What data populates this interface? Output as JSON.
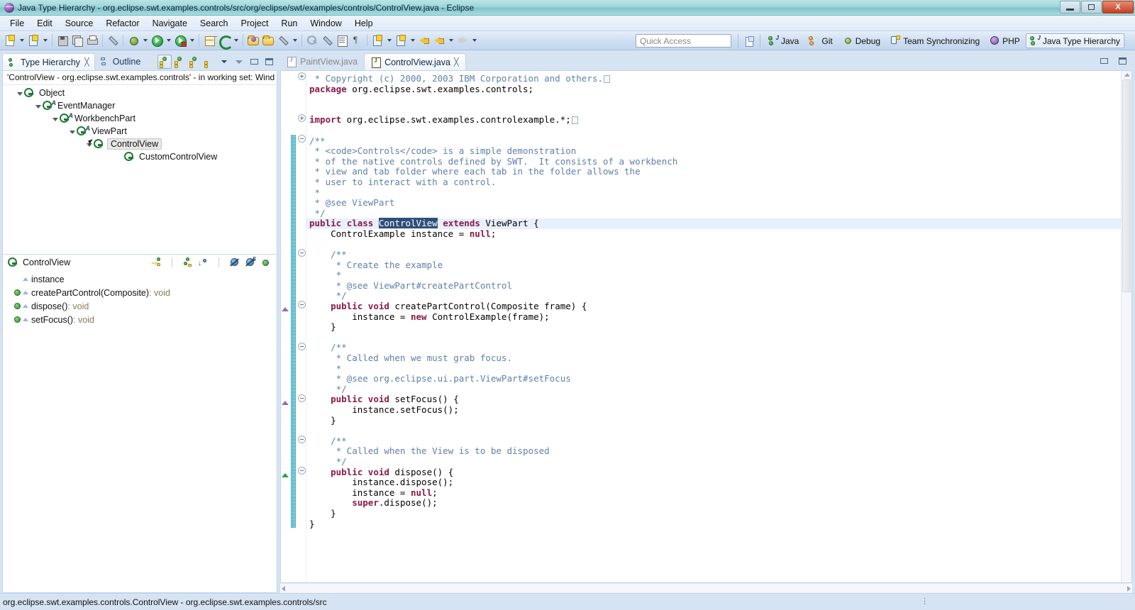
{
  "window": {
    "title": "Java Type Hierarchy - org.eclipse.swt.examples.controls/src/org/eclipse/swt/examples/controls/ControlView.java - Eclipse",
    "logo_icon": "eclipse-logo-icon",
    "minimize_label": "Minimize",
    "maximize_label": "Maximize",
    "close_label": "X"
  },
  "menu": {
    "items": [
      {
        "label": "File"
      },
      {
        "label": "Edit"
      },
      {
        "label": "Source"
      },
      {
        "label": "Refactor"
      },
      {
        "label": "Navigate"
      },
      {
        "label": "Search"
      },
      {
        "label": "Project"
      },
      {
        "label": "Run"
      },
      {
        "label": "Window"
      },
      {
        "label": "Help"
      }
    ]
  },
  "toolbar": {
    "quick_access_placeholder": "Quick Access",
    "icons": [
      "new-wizard-icon",
      "new-java-class-icon",
      "save-icon",
      "save-all-icon",
      "print-icon",
      "toggle-mark-occurrences-icon",
      "debug-icon",
      "run-icon",
      "run-external-tools-icon",
      "new-java-project-icon",
      "refresh-icon",
      "open-type-icon",
      "open-task-icon",
      "annotation-icon",
      "search-icon",
      "next-annotation-icon",
      "previous-annotation-icon",
      "toggle-block-selection-icon",
      "show-whitespace-icon",
      "back-icon",
      "forward-icon"
    ],
    "perspectives": [
      {
        "label": "Java",
        "icon": "java-perspective-icon",
        "active": false
      },
      {
        "label": "Git",
        "icon": "git-perspective-icon",
        "active": false
      },
      {
        "label": "Debug",
        "icon": "debug-perspective-icon",
        "active": false
      },
      {
        "label": "Team Synchronizing",
        "icon": "team-sync-perspective-icon",
        "active": false
      },
      {
        "label": "PHP",
        "icon": "php-perspective-icon",
        "active": false
      },
      {
        "label": "Java Type Hierarchy",
        "icon": "java-type-hierarchy-perspective-icon",
        "active": true
      }
    ],
    "open_perspective_icon": "open-perspective-icon"
  },
  "left_view": {
    "tabs": [
      {
        "label": "Type Hierarchy",
        "icon": "type-hierarchy-icon",
        "active": true,
        "closable": true
      },
      {
        "label": "Outline",
        "icon": "outline-icon",
        "active": false,
        "closable": false
      }
    ],
    "close_glyph": "╳",
    "tools": [
      "show-type-hierarchy-icon",
      "show-supertype-hierarchy-icon",
      "show-subtype-hierarchy-icon",
      "layout-menu-icon",
      "view-menu-icon",
      "minimize-icon",
      "maximize-icon"
    ],
    "header": "'ControlView - org.eclipse.swt.examples.controls' - in working set: Wind",
    "tree": [
      {
        "label": "Object",
        "indent": 0,
        "expanded": true,
        "modifier": "",
        "selected": false
      },
      {
        "label": "EventManager",
        "indent": 1,
        "expanded": true,
        "modifier": "A",
        "selected": false
      },
      {
        "label": "WorkbenchPart",
        "indent": 2,
        "expanded": true,
        "modifier": "A",
        "selected": false
      },
      {
        "label": "ViewPart",
        "indent": 3,
        "expanded": true,
        "modifier": "A",
        "selected": false
      },
      {
        "label": "ControlView",
        "indent": 4,
        "expanded": true,
        "modifier": "",
        "selected": true
      },
      {
        "label": "CustomControlView",
        "indent": 5,
        "expanded": false,
        "modifier": "",
        "selected": false
      }
    ],
    "members_title": "ControlView",
    "members_tools": [
      "focus-on-selection-icon",
      "show-inherited-members-icon",
      "sort-by-defining-type-icon",
      "hide-fields-icon",
      "hide-static-members-icon",
      "hide-non-public-members-icon"
    ],
    "members": [
      {
        "name": "instance",
        "returns": "",
        "kind": "field",
        "has_bullet": false
      },
      {
        "name": "createPartControl(Composite)",
        "returns": " : void",
        "kind": "method",
        "has_bullet": true
      },
      {
        "name": "dispose()",
        "returns": " : void",
        "kind": "method",
        "has_bullet": true
      },
      {
        "name": "setFocus()",
        "returns": " : void",
        "kind": "method",
        "has_bullet": true
      }
    ]
  },
  "editor": {
    "tabs": [
      {
        "label": "PaintView.java",
        "active": false,
        "closable": false
      },
      {
        "label": "ControlView.java",
        "active": true,
        "closable": true
      }
    ],
    "close_glyph": "╳",
    "tools": [
      "minimize-icon",
      "maximize-icon"
    ],
    "lines": [
      {
        "text": " * Copyright (c) 2000, 2003 IBM Corporation and others.",
        "type": "comment",
        "fold": "plus",
        "placeholder": true
      },
      {
        "text": "package org.eclipse.swt.examples.controls;",
        "type": "keyword-package"
      },
      {
        "text": "",
        "type": "blank"
      },
      {
        "text": "",
        "type": "blank"
      },
      {
        "text": "import org.eclipse.swt.examples.controlexample.*;",
        "type": "keyword-import",
        "fold": "plus",
        "placeholder": true
      },
      {
        "text": "",
        "type": "blank"
      },
      {
        "text": "/**",
        "type": "comment",
        "fold": "minus",
        "change": true
      },
      {
        "text": " * <code>Controls</code> is a simple demonstration",
        "type": "comment-tag",
        "change": true
      },
      {
        "text": " * of the native controls defined by SWT.  It consists of a workbench",
        "type": "comment",
        "change": true
      },
      {
        "text": " * view and tab folder where each tab in the folder allows the",
        "type": "comment",
        "change": true
      },
      {
        "text": " * user to interact with a control.",
        "type": "comment",
        "change": true
      },
      {
        "text": " *",
        "type": "comment",
        "change": true
      },
      {
        "text": " * @see ViewPart",
        "type": "comment",
        "change": true
      },
      {
        "text": " */",
        "type": "comment",
        "change": true
      },
      {
        "text": "public class ControlView extends ViewPart {",
        "type": "class-decl",
        "highlight": true,
        "change": true
      },
      {
        "text": "    ControlExample instance = null;",
        "type": "code",
        "change": true
      },
      {
        "text": "",
        "type": "blank",
        "change": true
      },
      {
        "text": "    /**",
        "type": "comment",
        "fold": "minus",
        "change": true
      },
      {
        "text": "     * Create the example",
        "type": "comment",
        "change": true
      },
      {
        "text": "     *",
        "type": "comment",
        "change": true
      },
      {
        "text": "     * @see ViewPart#createPartControl",
        "type": "comment",
        "change": true
      },
      {
        "text": "     */",
        "type": "comment",
        "change": true
      },
      {
        "text": "    public void createPartControl(Composite frame) {",
        "type": "code",
        "fold": "minus",
        "override": "impl",
        "change": true
      },
      {
        "text": "        instance = new ControlExample(frame);",
        "type": "code",
        "change": true
      },
      {
        "text": "    }",
        "type": "code",
        "change": true
      },
      {
        "text": "",
        "type": "blank",
        "change": true
      },
      {
        "text": "    /**",
        "type": "comment",
        "fold": "minus",
        "change": true
      },
      {
        "text": "     * Called when we must grab focus.",
        "type": "comment",
        "change": true
      },
      {
        "text": "     *",
        "type": "comment",
        "change": true
      },
      {
        "text": "     * @see org.eclipse.ui.part.ViewPart#setFocus",
        "type": "comment",
        "change": true
      },
      {
        "text": "     */",
        "type": "comment",
        "change": true
      },
      {
        "text": "    public void setFocus() {",
        "type": "code",
        "fold": "minus",
        "override": "impl",
        "change": true
      },
      {
        "text": "        instance.setFocus();",
        "type": "code",
        "change": true
      },
      {
        "text": "    }",
        "type": "code",
        "change": true
      },
      {
        "text": "",
        "type": "blank",
        "change": true
      },
      {
        "text": "    /**",
        "type": "comment",
        "fold": "minus",
        "change": true
      },
      {
        "text": "     * Called when the View is to be disposed",
        "type": "comment",
        "change": true
      },
      {
        "text": "     */",
        "type": "comment",
        "change": true
      },
      {
        "text": "    public void dispose() {",
        "type": "code",
        "fold": "minus",
        "override": "override",
        "change": true
      },
      {
        "text": "        instance.dispose();",
        "type": "code",
        "change": true
      },
      {
        "text": "        instance = null;",
        "type": "code",
        "change": true
      },
      {
        "text": "        super.dispose();",
        "type": "code",
        "change": true
      },
      {
        "text": "    }",
        "type": "code",
        "change": true
      },
      {
        "text": "}",
        "type": "code"
      }
    ],
    "selected_token": "ControlView"
  },
  "status": {
    "text": "org.eclipse.swt.examples.controls.ControlView - org.eclipse.swt.examples.controls/src",
    "grip": "⋮"
  },
  "colors": {
    "titlebar": "#9fd6da",
    "chrome": "#d6e3f3",
    "accent": "#2e4f7a",
    "keyword": "#8a1a4a",
    "comment": "#5f7fa8",
    "change_bar": "#24a0b5",
    "close_button": "#c43f22"
  }
}
